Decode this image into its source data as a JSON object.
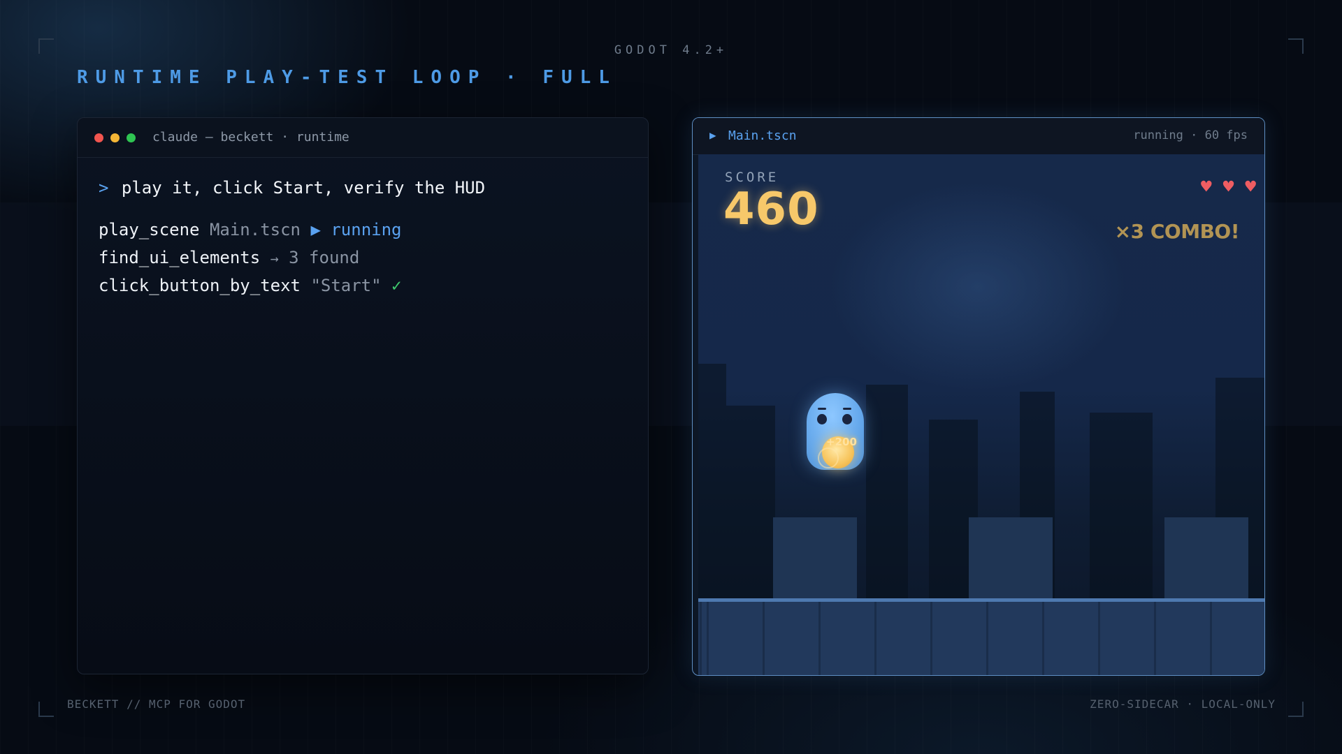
{
  "header": {
    "engine_label": "GODOT 4.2+",
    "title": "RUNTIME PLAY-TEST LOOP · FULL"
  },
  "footer": {
    "left": "BECKETT // MCP FOR GODOT",
    "right": "ZERO-SIDECAR · LOCAL-ONLY"
  },
  "terminal": {
    "title": "claude — beckett · runtime",
    "prompt_symbol": ">",
    "prompt": "play it, click Start, verify the HUD",
    "lines": [
      {
        "command": "play_scene",
        "arg": "Main.tscn",
        "indicator": "▶",
        "status": "running"
      },
      {
        "command": "find_ui_elements",
        "arrow": "→",
        "result": "3 found"
      },
      {
        "command": "click_button_by_text",
        "arg": "\"Start\"",
        "check": "✓"
      }
    ]
  },
  "game_window": {
    "play_icon": "▶",
    "scene_tab": "Main.tscn",
    "status": "running · 60 fps",
    "hud": {
      "score_label": "SCORE",
      "score_value": "460",
      "hearts": [
        "♥",
        "♥",
        "♥"
      ],
      "combo": "×3 COMBO!",
      "popup": "+200"
    }
  },
  "colors": {
    "accent": "#4e9be6",
    "score": "#f7c86a",
    "heart": "#ef5d62",
    "combo": "#b29454",
    "check": "#3ec96d",
    "window_border": "#5f8fc4"
  },
  "icons": [
    "play-icon",
    "heart-icon",
    "check-icon",
    "arrow-right-icon"
  ]
}
